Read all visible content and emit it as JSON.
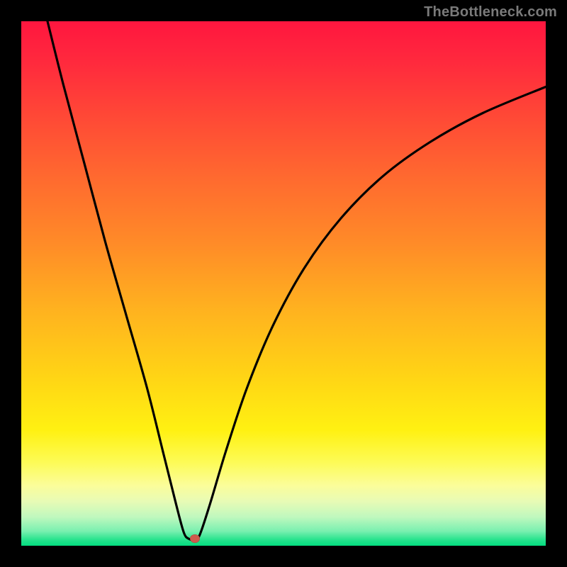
{
  "watermark": "TheBottleneck.com",
  "marker": {
    "x_pct": 33.1,
    "y_pct": 98.7,
    "color": "#cf5a4d"
  },
  "gradient": {
    "stops": [
      {
        "offset": 0.0,
        "color": "#ff163f"
      },
      {
        "offset": 0.08,
        "color": "#ff2a3d"
      },
      {
        "offset": 0.18,
        "color": "#ff4836"
      },
      {
        "offset": 0.3,
        "color": "#ff6a2f"
      },
      {
        "offset": 0.42,
        "color": "#ff8a28"
      },
      {
        "offset": 0.55,
        "color": "#ffb21f"
      },
      {
        "offset": 0.68,
        "color": "#ffd515"
      },
      {
        "offset": 0.78,
        "color": "#fff112"
      },
      {
        "offset": 0.84,
        "color": "#fdfb55"
      },
      {
        "offset": 0.885,
        "color": "#fbfd9a"
      },
      {
        "offset": 0.915,
        "color": "#e8fbb5"
      },
      {
        "offset": 0.945,
        "color": "#c0f8be"
      },
      {
        "offset": 0.972,
        "color": "#7af0b0"
      },
      {
        "offset": 0.988,
        "color": "#29e38e"
      },
      {
        "offset": 1.0,
        "color": "#03dd80"
      }
    ]
  },
  "chart_data": {
    "type": "line",
    "title": "",
    "xlabel": "",
    "ylabel": "",
    "x_range": [
      0,
      100
    ],
    "y_range": [
      0,
      100
    ],
    "series": [
      {
        "name": "bottleneck-curve",
        "points": [
          {
            "x": 5.0,
            "y": 100.0
          },
          {
            "x": 8.0,
            "y": 88.0
          },
          {
            "x": 12.0,
            "y": 73.0
          },
          {
            "x": 16.0,
            "y": 58.0
          },
          {
            "x": 20.0,
            "y": 44.0
          },
          {
            "x": 24.0,
            "y": 30.0
          },
          {
            "x": 27.0,
            "y": 18.0
          },
          {
            "x": 29.5,
            "y": 8.0
          },
          {
            "x": 31.0,
            "y": 2.5
          },
          {
            "x": 32.0,
            "y": 1.3
          },
          {
            "x": 33.0,
            "y": 1.2
          },
          {
            "x": 34.0,
            "y": 2.0
          },
          {
            "x": 36.0,
            "y": 8.0
          },
          {
            "x": 39.0,
            "y": 18.0
          },
          {
            "x": 43.0,
            "y": 30.0
          },
          {
            "x": 48.0,
            "y": 42.0
          },
          {
            "x": 54.0,
            "y": 53.0
          },
          {
            "x": 61.0,
            "y": 62.5
          },
          {
            "x": 69.0,
            "y": 70.5
          },
          {
            "x": 78.0,
            "y": 77.0
          },
          {
            "x": 88.0,
            "y": 82.5
          },
          {
            "x": 100.0,
            "y": 87.5
          }
        ]
      }
    ],
    "annotations": [
      {
        "type": "marker",
        "x": 33.1,
        "y": 1.3,
        "label": "optimal-point"
      }
    ]
  }
}
